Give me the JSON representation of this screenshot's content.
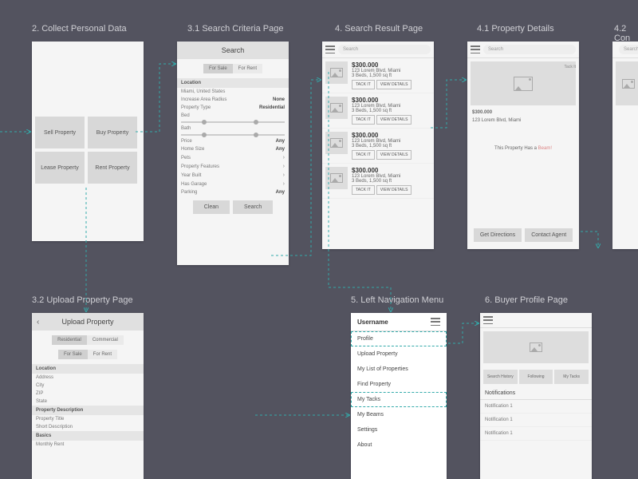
{
  "labels": {
    "s2": "2. Collect Personal Data",
    "s31": "3.1 Search Criteria Page",
    "s4": "4. Search Result Page",
    "s41": "4.1 Property Details",
    "s42": "4.2 Con",
    "s32": "3.2 Upload Property Page",
    "s5": "5. Left Navigation Menu",
    "s6": "6. Buyer Profile Page"
  },
  "collect": {
    "tiles": [
      "Sell Property",
      "Buy Property",
      "Lease Property",
      "Rent Property"
    ]
  },
  "search": {
    "title": "Search",
    "tabs": [
      "For Sale",
      "For Rent"
    ],
    "location_hdr": "Location",
    "location_val": "Miami, United States",
    "rows": [
      {
        "l": "Increase Area Radius",
        "v": "None"
      },
      {
        "l": "Property Type",
        "v": "Residential"
      },
      {
        "l": "Bed",
        "slider": true
      },
      {
        "l": "Bath",
        "slider": true
      },
      {
        "l": "Price",
        "v": "Any"
      },
      {
        "l": "Home Size",
        "v": "Any"
      },
      {
        "l": "Pets",
        "chev": true
      },
      {
        "l": "Property Features",
        "chev": true
      },
      {
        "l": "Year Built",
        "chev": true
      },
      {
        "l": "Has Garage",
        "chev": true
      },
      {
        "l": "Parking",
        "v": "Any"
      }
    ],
    "clean": "Clean",
    "search_btn": "Search"
  },
  "results": {
    "search_ph": "Search",
    "item": {
      "price": "$300.000",
      "addr": "123 Lorem Blvd, Miami",
      "meta": "3 Beds, 1,500 sq ft",
      "tack": "TACK IT",
      "view": "VIEW DETAILS"
    }
  },
  "details": {
    "search_ph": "Search",
    "tack": "Tack It",
    "price": "$300.000",
    "addr": "123 Lorem Blvd, Miami",
    "note_pre": "This Property Has a ",
    "note_link": "Beam!",
    "dir": "Get Directions",
    "contact": "Contact Agent"
  },
  "upload": {
    "title": "Upload Property",
    "tabs1": [
      "Residential",
      "Commercial"
    ],
    "tabs2": [
      "For Sale",
      "For Rent"
    ],
    "loc_hdr": "Location",
    "loc": [
      "Address",
      "City",
      "ZIP",
      "State"
    ],
    "desc_hdr": "Property Description",
    "desc": [
      "Property Title",
      "Short Description"
    ],
    "basics_hdr": "Basics",
    "basics": [
      "Monthly Rent"
    ]
  },
  "nav": {
    "user": "Username",
    "items": [
      "Profile",
      "Upload Property",
      "My List of Properties",
      "Find Property",
      "My Tacks",
      "My Beams",
      "Settings",
      "About"
    ]
  },
  "profile": {
    "tabs": [
      "Search History",
      "Following",
      "My Tacks"
    ],
    "notif_hdr": "Notifications",
    "notifs": [
      "Notification 1",
      "Notification 1",
      "Notification 1"
    ]
  }
}
